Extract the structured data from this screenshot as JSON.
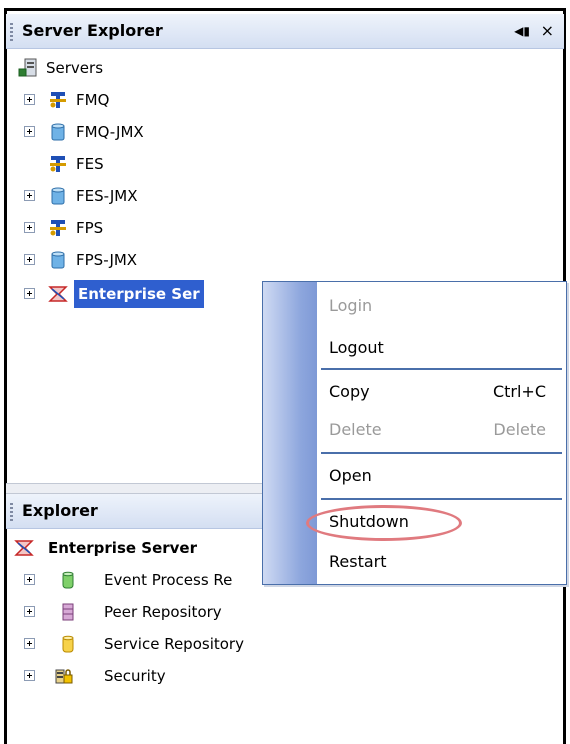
{
  "server_explorer": {
    "title": "Server Explorer",
    "pin_icon": "pin-icon",
    "close_label": "×",
    "root_label": "Servers",
    "items": [
      {
        "label": "FMQ",
        "icon": "server-gear-icon"
      },
      {
        "label": "FMQ-JMX",
        "icon": "cylinder-server-icon"
      },
      {
        "label": "FES",
        "icon": "server-gear-icon"
      },
      {
        "label": "FES-JMX",
        "icon": "cylinder-server-icon"
      },
      {
        "label": "FPS",
        "icon": "server-gear-icon"
      },
      {
        "label": "FPS-JMX",
        "icon": "cylinder-server-icon"
      },
      {
        "label": "Enterprise Ser",
        "icon": "enterprise-server-icon",
        "selected": true
      }
    ]
  },
  "context_menu": {
    "login": "Login",
    "logout": "Logout",
    "copy": "Copy",
    "copy_shortcut": "Ctrl+C",
    "delete": "Delete",
    "delete_shortcut": "Delete",
    "open": "Open",
    "shutdown": "Shutdown",
    "restart": "Restart"
  },
  "explorer": {
    "title": "Explorer",
    "root_label": "Enterprise Server",
    "items": [
      {
        "label": "Event Process Re",
        "icon": "green-cylinder-icon"
      },
      {
        "label": "Peer Repository",
        "icon": "purple-stack-icon"
      },
      {
        "label": "Service Repository",
        "icon": "yellow-cylinder-icon"
      },
      {
        "label": "Security",
        "icon": "security-icon"
      }
    ]
  },
  "colors": {
    "selection": "#2f5fcf",
    "menu_border": "#4a6faa",
    "highlight_ring": "#e07a7f"
  }
}
